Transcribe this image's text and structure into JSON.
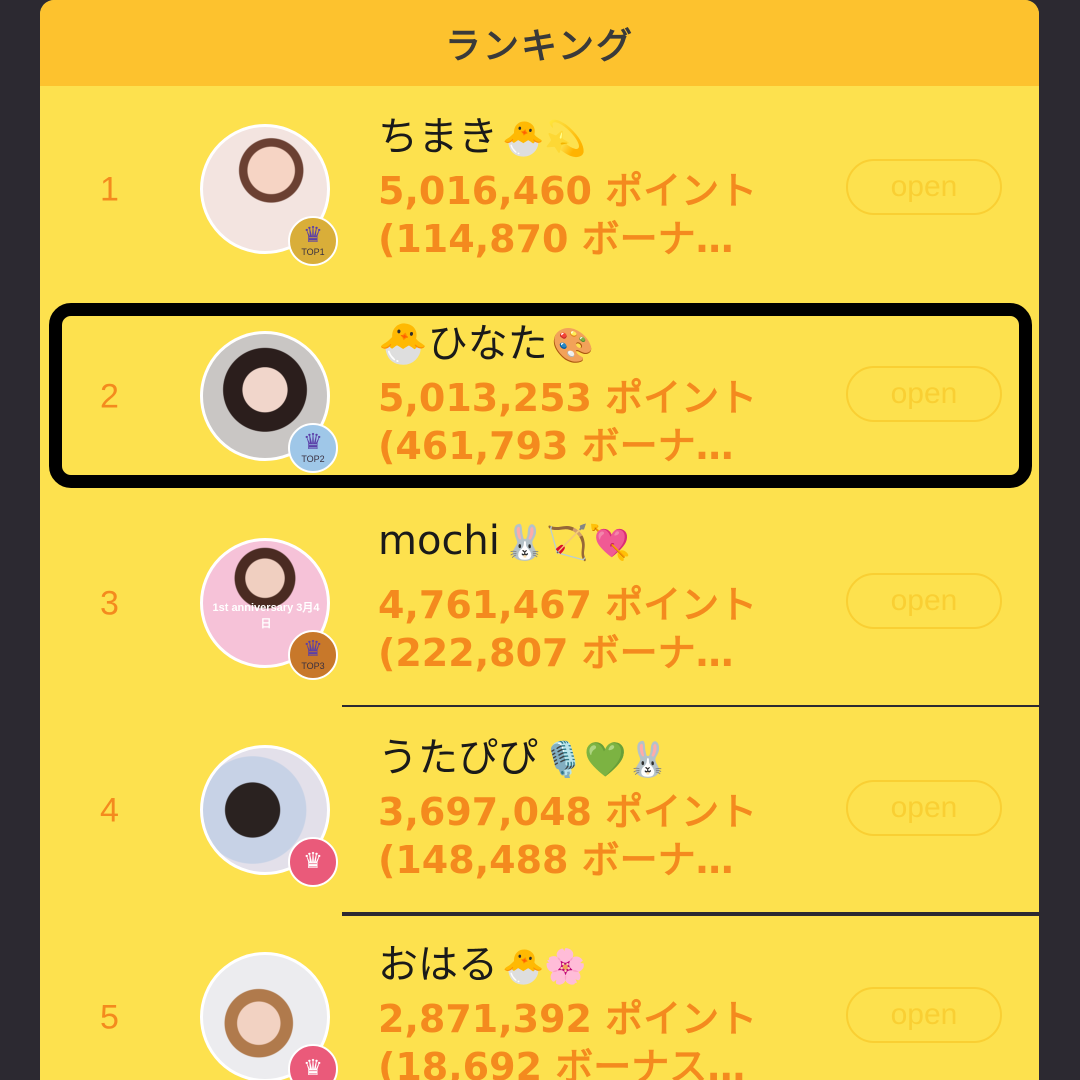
{
  "header": {
    "title": "ランキング"
  },
  "rows": [
    {
      "rank": "1",
      "name": "ちまき",
      "emojis": "🐣💫",
      "points": "5,016,460 ポイント",
      "bonus": "(114,870 ボーナ…",
      "open_label": "open",
      "badge": "TOP1"
    },
    {
      "rank": "2",
      "name": "🐣ひなた",
      "emojis": "🎨",
      "points": "5,013,253 ポイント",
      "bonus": "(461,793 ボーナ…",
      "open_label": "open",
      "badge": "TOP2"
    },
    {
      "rank": "3",
      "name": "mochi",
      "emojis": "🐰🏹💘",
      "points": "4,761,467 ポイント",
      "bonus": "(222,807 ボーナ…",
      "open_label": "open",
      "badge": "TOP3",
      "avatar_text": "1st anniversary 3月4日"
    },
    {
      "rank": "4",
      "name": "うたぴぴ",
      "emojis": "🎙️💚🐰",
      "points": "3,697,048 ポイント",
      "bonus": "(148,488 ボーナ…",
      "open_label": "open",
      "badge": ""
    },
    {
      "rank": "5",
      "name": "おはる",
      "emojis": "🐣🌸",
      "points": "2,871,392 ポイント",
      "bonus": "(18,692 ボーナス…",
      "open_label": "open",
      "badge": ""
    }
  ],
  "colors": {
    "background": "#2c2931",
    "panel": "#fde14e",
    "header": "#fdc22e",
    "accent_orange": "#f48a1e",
    "open_button": "#f9cf33",
    "highlight_border": "#000000"
  }
}
